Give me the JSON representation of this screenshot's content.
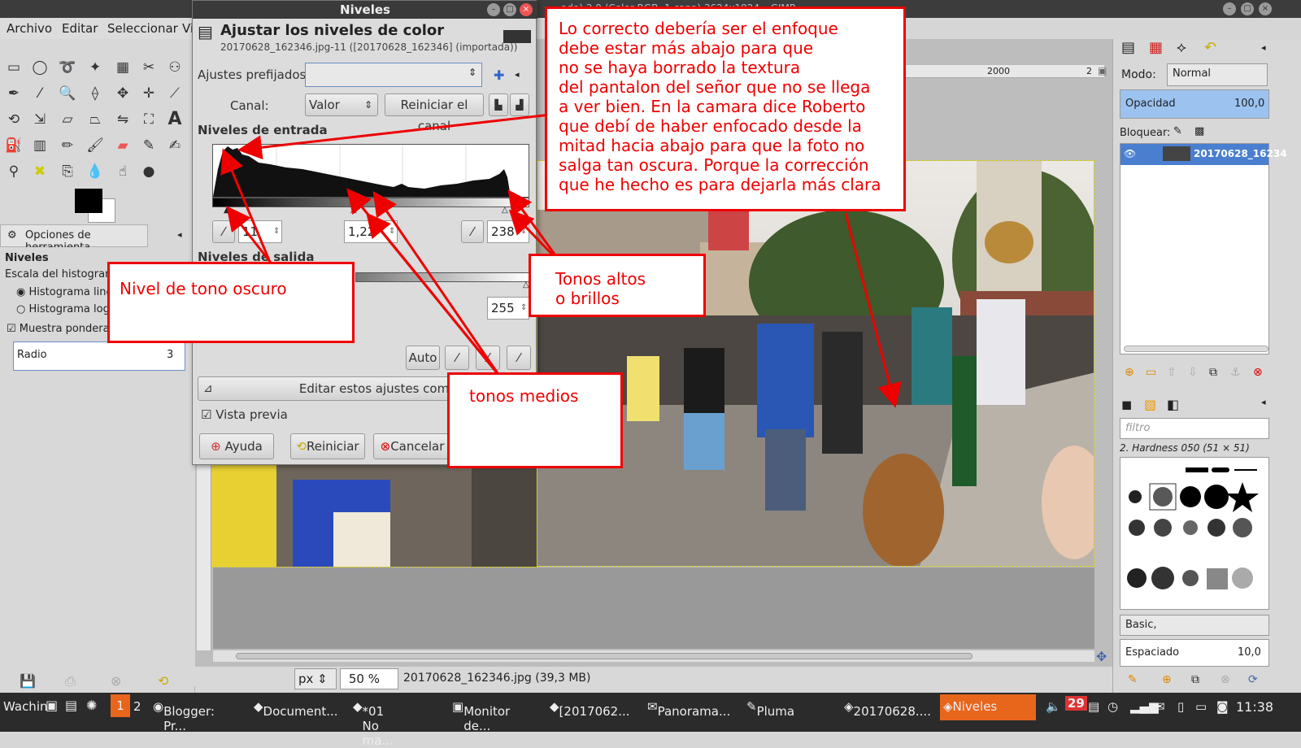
{
  "window": {
    "title_partial": "ado) 3.0 (Color RGB, 1 capa) 3624x1924 – GIMP",
    "menu": [
      "Archivo",
      "Editar",
      "Seleccionar",
      "Vi"
    ]
  },
  "toolbox": {
    "tool_options_tab": "Opciones de herramienta",
    "section_title": "Niveles",
    "histogram_scale_label": "Escala del histograma",
    "radio_linear": "Histograma line",
    "radio_log": "Histograma loga",
    "checkbox_sample": "Muestra pondera",
    "radius_label": "Radio",
    "radius_value": "3"
  },
  "dialog": {
    "title": "Niveles",
    "heading": "Ajustar los niveles de color",
    "subheading": "20170628_162346.jpg-11 ([20170628_162346] (importada))",
    "presets_label": "Ajustes prefijados:",
    "channel_label": "Canal:",
    "channel_value": "Valor",
    "reset_channel": "Reiniciar el canal",
    "input_levels": "Niveles de entrada",
    "input_low": "11",
    "input_gamma": "1,22",
    "input_high": "238",
    "output_levels": "Niveles de salida",
    "output_high": "255",
    "auto": "Auto",
    "edit_as_curves": "Editar estos ajustes como cur",
    "preview": "Vista previa",
    "help": "Ayuda",
    "reset": "Reiniciar",
    "cancel": "Cancelar"
  },
  "canvas": {
    "ruler_mark": "2000",
    "ruler_mark_2": "2",
    "unit": "px",
    "zoom": "50 %",
    "file_info": "20170628_162346.jpg (39,3 MB)"
  },
  "dock": {
    "mode_label": "Modo:",
    "mode_value": "Normal",
    "opacity_label": "Opacidad",
    "opacity_value": "100,0",
    "lock_label": "Bloquear:",
    "layer_name": "20170628_16234",
    "filter_placeholder": "filtro",
    "brush_name": "2. Hardness 050 (51 × 51)",
    "brush_set": "Basic,",
    "spacing_label": "Espaciado",
    "spacing_value": "10,0"
  },
  "callouts": {
    "main": "Lo correcto debería ser el enfoque\ndebe estar más abajo para que\nno se haya borrado la textura\ndel pantalon del señor que no se llega\na ver bien. En la camara dice Roberto\nque debí de haber enfocado desde la\nmitad hacia abajo para que la foto no\nsalga tan oscura. Porque la corrección\nque he hecho es para dejarla más clara",
    "dark": "Nivel de tono oscuro",
    "highlights": "Tonos altos\no brillos",
    "midtones": "tonos medios"
  },
  "taskbar": {
    "user": "Wachin",
    "ws1": "1",
    "ws2": "2",
    "items": [
      "Blogger: Pr...",
      "Document...",
      "*01 No ma...",
      "Monitor de...",
      "[2017062...",
      "Panorama...",
      "Pluma",
      "20170628....",
      "Niveles"
    ],
    "date_day": "29",
    "clock": "11:38"
  },
  "colors": {
    "callout": "#e00000",
    "dialog_bg": "#dcdcdc",
    "selection": "#9cc3f0",
    "taskbar_active": "#e8651c"
  }
}
